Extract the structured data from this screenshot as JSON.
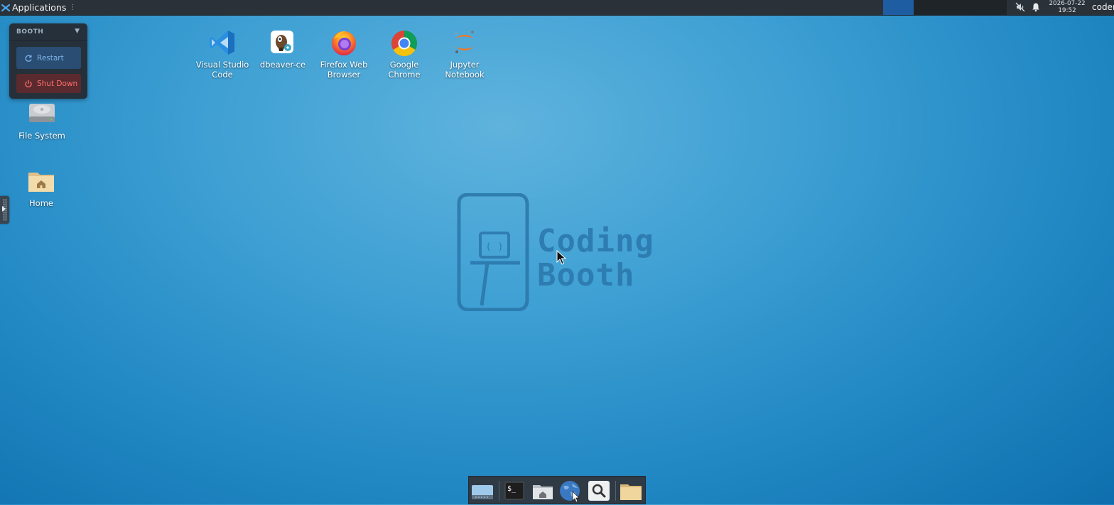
{
  "top_panel": {
    "applications_label": "Applications",
    "menu_dots": "⋮",
    "clock_date": "2026-07-22",
    "clock_time": "19:52",
    "user": "coder"
  },
  "booth_widget": {
    "title": "BOOTH",
    "caret": "▼",
    "restart_label": "Restart",
    "shutdown_label": "Shut Down"
  },
  "desktop_icons": {
    "vscode": {
      "line1": "Visual Studio",
      "line2": "Code"
    },
    "dbeaver": {
      "line1": "dbeaver-ce",
      "line2": ""
    },
    "firefox": {
      "line1": "Firefox Web",
      "line2": "Browser"
    },
    "chrome": {
      "line1": "Google",
      "line2": "Chrome"
    },
    "jupyter": {
      "line1": "Jupyter",
      "line2": "Notebook"
    },
    "filesystem": {
      "line1": "File System"
    },
    "home": {
      "line1": "Home"
    }
  },
  "watermark": {
    "line1": "Coding",
    "line2": "Booth"
  },
  "dock": {
    "items": [
      "show-desktop-icon",
      "terminal-icon",
      "home-folder-icon",
      "web-browser-icon",
      "search-icon",
      "file-manager-icon"
    ]
  },
  "colors": {
    "panel": "#2b3138",
    "workspace_active": "#1f5da3",
    "desktop_bg": "#1f86c2",
    "restart_bg": "#294d73",
    "shutdown_bg": "#5a2a2e"
  }
}
